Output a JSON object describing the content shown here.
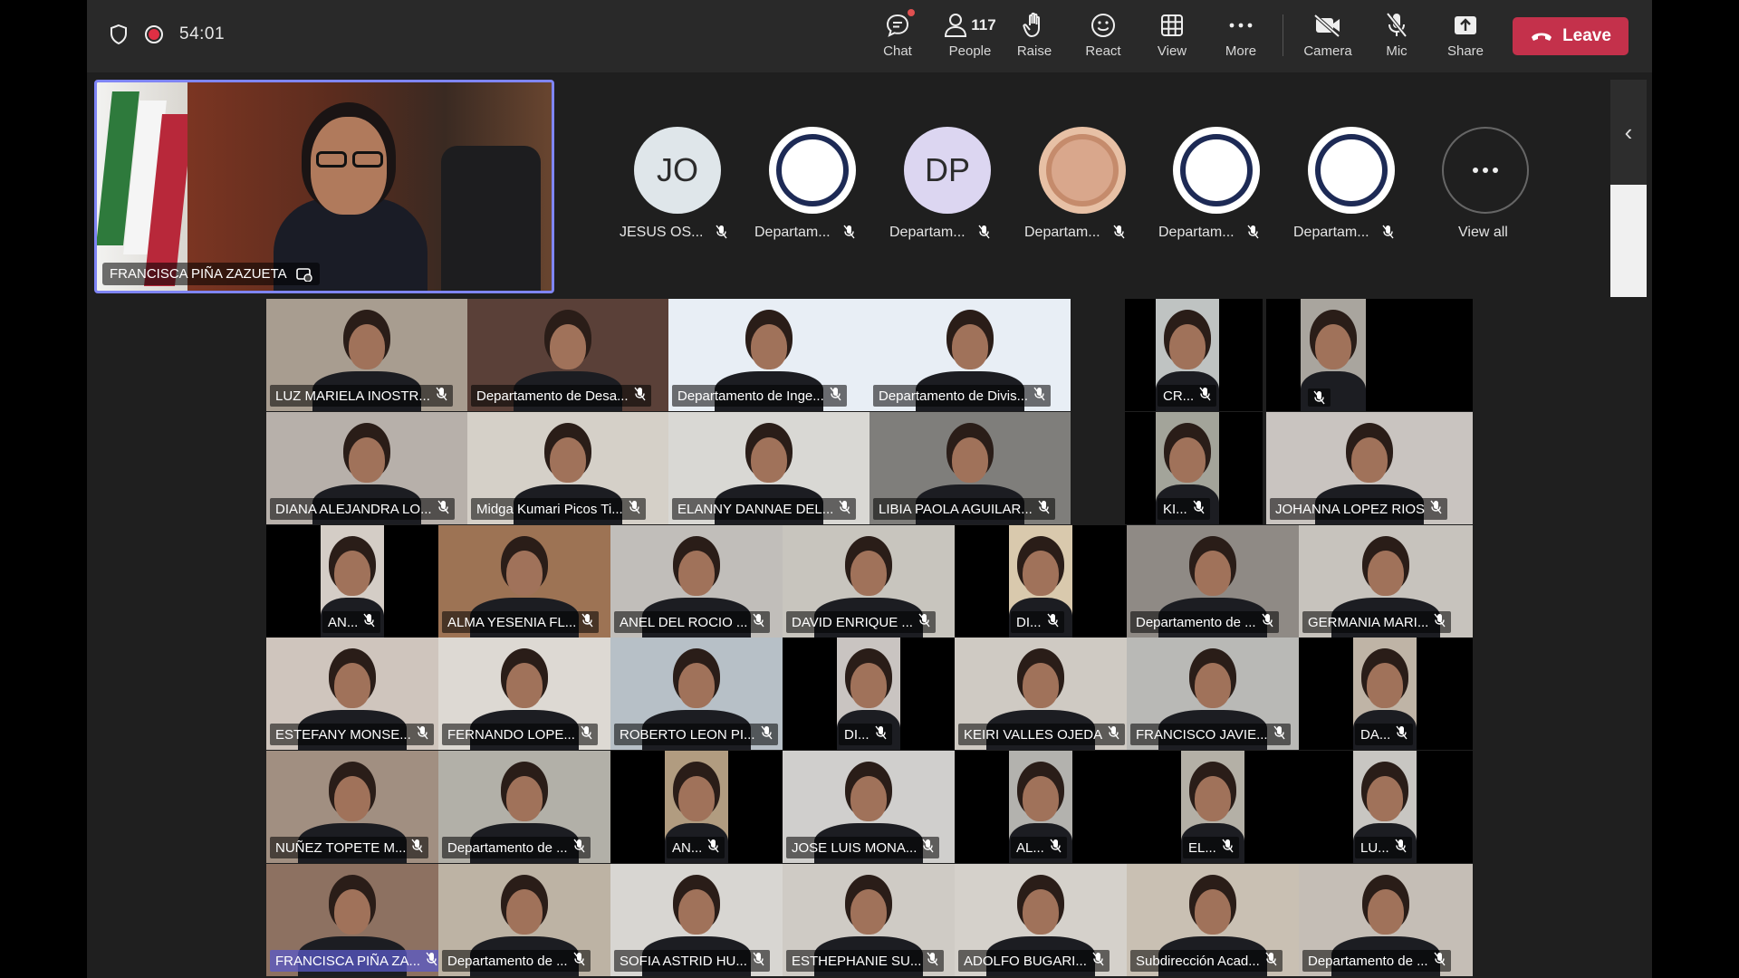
{
  "topbar": {
    "timer": "54:01",
    "chat": "Chat",
    "people": "People",
    "people_count": "117",
    "raise": "Raise",
    "react": "React",
    "view": "View",
    "more": "More",
    "camera": "Camera",
    "mic": "Mic",
    "share": "Share",
    "leave": "Leave"
  },
  "pinned": {
    "name": "FRANCISCA PIÑA ZAZUETA"
  },
  "strip": [
    {
      "initials": "JO",
      "label": "JESUS OS...",
      "color": "#dfe6ea"
    },
    {
      "initials": "",
      "label": "Departam...",
      "color": "#ffffff"
    },
    {
      "initials": "DP",
      "label": "Departam...",
      "color": "#dcd6f1"
    },
    {
      "initials": "",
      "label": "Departam...",
      "color": "#e7c0a5"
    },
    {
      "initials": "",
      "label": "Departam...",
      "color": "#ffffff"
    },
    {
      "initials": "",
      "label": "Departam...",
      "color": "#ffffff"
    }
  ],
  "view_all": "View all",
  "gallery": {
    "tiles": [
      {
        "name": "LUZ MARIELA INOSTR...",
        "bg": "#a89d90"
      },
      {
        "name": "Departamento de Desa...",
        "bg": "#5a4038"
      },
      {
        "name": "Departamento de Inge...",
        "bg": "#e8eef5"
      },
      {
        "name": "Departamento de Divis...",
        "bg": "#e8eef5"
      },
      {
        "name": "CR...",
        "bg": "#bfc3c2"
      },
      {
        "name": "",
        "bg": "#a9a59e"
      },
      {
        "name": "DIANA ALEJANDRA LO...",
        "bg": "#b7b0aa"
      },
      {
        "name": "Midga Kumari Picos Ti...",
        "bg": "#d5d0c8"
      },
      {
        "name": "ELANNY DANNAE DEL...",
        "bg": "#d9d8d4"
      },
      {
        "name": "LIBIA PAOLA AGUILAR...",
        "bg": "#7f7e7b"
      },
      {
        "name": "KI...",
        "bg": "#a3a49a"
      },
      {
        "name": "JOHANNA LOPEZ RIOS",
        "bg": "#c9c4c0"
      },
      {
        "name": "AN...",
        "bg": "#d4cdc6"
      },
      {
        "name": "ALMA YESENIA FL...",
        "bg": "#9d7354"
      },
      {
        "name": "ANEL DEL ROCIO ...",
        "bg": "#c1beba"
      },
      {
        "name": "DAVID ENRIQUE ...",
        "bg": "#c8c5be"
      },
      {
        "name": "DI...",
        "bg": "#d9c9ad"
      },
      {
        "name": "Departamento de ...",
        "bg": "#8f8a85"
      },
      {
        "name": "GERMANIA MARI...",
        "bg": "#c7c3bd"
      },
      {
        "name": "ESTEFANY MONSE...",
        "bg": "#cfc5bd"
      },
      {
        "name": "FERNANDO LOPE...",
        "bg": "#ddd9d3"
      },
      {
        "name": "ROBERTO LEON PI...",
        "bg": "#b7c0c7"
      },
      {
        "name": "DI...",
        "bg": "#c9c4c1"
      },
      {
        "name": "KEIRI VALLES OJEDA",
        "bg": "#cfcac3"
      },
      {
        "name": "FRANCISCO JAVIE...",
        "bg": "#b9b9b6"
      },
      {
        "name": "DA...",
        "bg": "#bfb4a6"
      },
      {
        "name": "NUÑEZ TOPETE M...",
        "bg": "#a18f81"
      },
      {
        "name": "Departamento de ...",
        "bg": "#b2b0a8"
      },
      {
        "name": "AN...",
        "bg": "#b19c80"
      },
      {
        "name": "JOSE LUIS MONA...",
        "bg": "#d0cfcd"
      },
      {
        "name": "AL...",
        "bg": "#b3b2ae"
      },
      {
        "name": "EL...",
        "bg": "#b4b0a6"
      },
      {
        "name": "LU...",
        "bg": "#c8c6c2"
      },
      {
        "name": "FRANCISCA PIÑA ZA...",
        "bg": "#8d7161"
      },
      {
        "name": "Departamento de ...",
        "bg": "#bdb3a4"
      },
      {
        "name": "SOFIA ASTRID HU...",
        "bg": "#d8d6d2"
      },
      {
        "name": "ESTHEPHANIE SU...",
        "bg": "#cfcbc5"
      },
      {
        "name": "ADOLFO BUGARI...",
        "bg": "#d5d1cb"
      },
      {
        "name": "Subdirección Acad...",
        "bg": "#c9c0b3"
      },
      {
        "name": "Departamento de ...",
        "bg": "#c5beb6"
      }
    ]
  }
}
